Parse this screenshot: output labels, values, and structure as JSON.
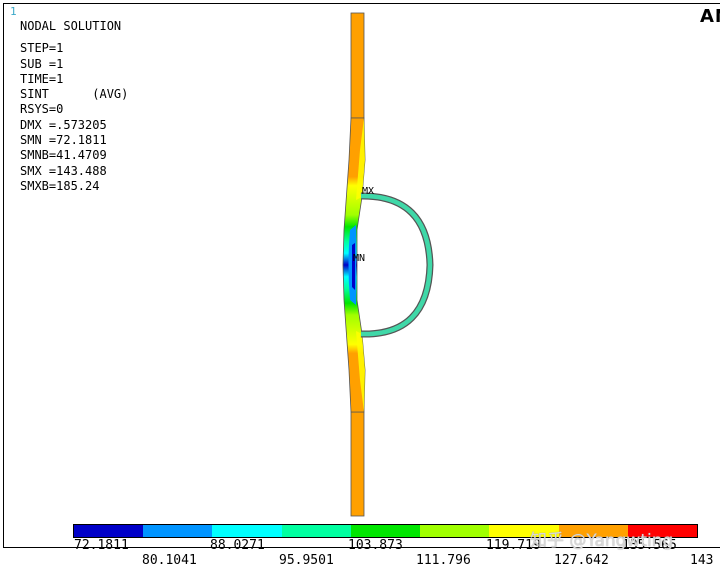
{
  "window": {
    "number": "1",
    "brand": "AN"
  },
  "info": {
    "title": "NODAL SOLUTION",
    "lines": [
      "STEP=1",
      "SUB =1",
      "TIME=1",
      "SINT      (AVG)",
      "RSYS=0",
      "DMX =.573205",
      "SMN =72.1811",
      "SMNB=41.4709",
      "SMX =143.488",
      "SMXB=185.24"
    ]
  },
  "plot_labels": {
    "max": "MX",
    "min": "MN"
  },
  "legend": {
    "colors": [
      "#0000c8",
      "#0094ff",
      "#00ffff",
      "#00ffa0",
      "#00e600",
      "#a0ff00",
      "#ffff00",
      "#ffa000",
      "#ff0000"
    ],
    "top_labels": [
      "72.1811",
      "88.0271",
      "103.873",
      "119.719",
      "135.565"
    ],
    "bottom_labels": [
      "80.1041",
      "95.9501",
      "111.796",
      "127.642",
      "143"
    ]
  },
  "watermark": "知乎 @Yangwting"
}
